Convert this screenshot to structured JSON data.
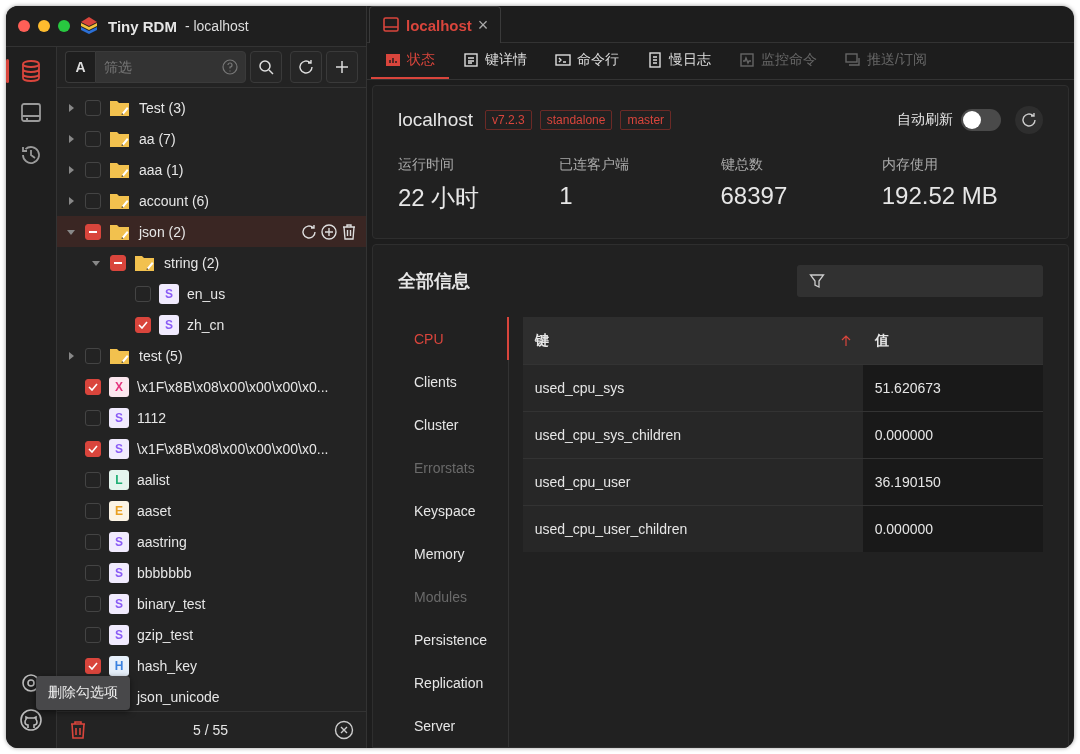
{
  "window": {
    "app_name": "Tiny RDM",
    "title": "- localhost"
  },
  "rail": [
    {
      "kind": "database",
      "selected": true
    },
    {
      "kind": "terminal",
      "selected": false
    },
    {
      "kind": "history",
      "selected": false
    }
  ],
  "toolbar": {
    "case_button": "A",
    "filter": {
      "placeholder": "筛选"
    }
  },
  "tree": [
    {
      "kind": "folder",
      "label": "Test (3)",
      "checked": false,
      "partial": false,
      "expanded": false,
      "selected": false
    },
    {
      "kind": "folder",
      "label": "aa (7)",
      "checked": false,
      "partial": false,
      "expanded": false,
      "selected": false
    },
    {
      "kind": "folder",
      "label": "aaa (1)",
      "checked": false,
      "partial": false,
      "expanded": false,
      "selected": false
    },
    {
      "kind": "folder",
      "label": "account (6)",
      "checked": false,
      "partial": false,
      "expanded": false,
      "selected": false
    },
    {
      "kind": "folder",
      "label": "json (2)",
      "checked": false,
      "partial": true,
      "expanded": true,
      "selected": true,
      "children": [
        {
          "kind": "folder",
          "label": "string (2)",
          "checked": false,
          "partial": true,
          "expanded": true,
          "selected": false,
          "children": [
            {
              "kind": "key",
              "badge": "S",
              "color": "#8b5cf6",
              "label": "en_us",
              "checked": false,
              "selected": false
            },
            {
              "kind": "key",
              "badge": "S",
              "color": "#8b5cf6",
              "label": "zh_cn",
              "checked": true,
              "selected": false
            }
          ]
        }
      ]
    },
    {
      "kind": "folder",
      "label": "test (5)",
      "checked": false,
      "partial": false,
      "expanded": false,
      "selected": false
    },
    {
      "kind": "key",
      "badge": "X",
      "color": "#e5337c",
      "label": "\\x1F\\x8B\\x08\\x00\\x00\\x00\\x0...",
      "checked": true,
      "selected": false
    },
    {
      "kind": "key",
      "badge": "S",
      "color": "#8b5cf6",
      "label": "1112",
      "checked": false,
      "selected": false
    },
    {
      "kind": "key",
      "badge": "S",
      "color": "#8b5cf6",
      "label": "\\x1F\\x8B\\x08\\x00\\x00\\x00\\x0...",
      "checked": true,
      "selected": false
    },
    {
      "kind": "key",
      "badge": "L",
      "color": "#1fae74",
      "label": "aalist",
      "checked": false,
      "selected": false
    },
    {
      "kind": "key",
      "badge": "E",
      "color": "#e9a023",
      "label": "aaset",
      "checked": false,
      "selected": false
    },
    {
      "kind": "key",
      "badge": "S",
      "color": "#8b5cf6",
      "label": "aastring",
      "checked": false,
      "selected": false
    },
    {
      "kind": "key",
      "badge": "S",
      "color": "#8b5cf6",
      "label": "bbbbbbb",
      "checked": false,
      "selected": false
    },
    {
      "kind": "key",
      "badge": "S",
      "color": "#8b5cf6",
      "label": "binary_test",
      "checked": false,
      "selected": false
    },
    {
      "kind": "key",
      "badge": "S",
      "color": "#8b5cf6",
      "label": "gzip_test",
      "checked": false,
      "selected": false
    },
    {
      "kind": "key",
      "badge": "H",
      "color": "#3b82e0",
      "label": "hash_key",
      "checked": true,
      "selected": false
    },
    {
      "kind": "key",
      "label": "json_unicode",
      "selected": false
    }
  ],
  "tooltip": "删除勾选项",
  "footer": {
    "count": "5 / 55"
  },
  "tab": {
    "label": "localhost",
    "close": "×"
  },
  "subtabs": [
    {
      "kind": "status",
      "label": "状态",
      "selected": true,
      "disabled": false
    },
    {
      "kind": "detail",
      "label": "键详情",
      "selected": false,
      "disabled": false
    },
    {
      "kind": "cli",
      "label": "命令行",
      "selected": false,
      "disabled": false
    },
    {
      "kind": "log",
      "label": "慢日志",
      "selected": false,
      "disabled": false
    },
    {
      "kind": "monitor",
      "label": "监控命令",
      "selected": false,
      "disabled": true
    },
    {
      "kind": "pubsub",
      "label": "推送/订阅",
      "selected": false,
      "disabled": true
    }
  ],
  "server": {
    "name": "localhost",
    "tags": [
      "v7.2.3",
      "standalone",
      "master"
    ],
    "auto_refresh": {
      "label": "自动刷新",
      "on": false
    },
    "stats": [
      {
        "label": "运行时间",
        "value": "22 小时"
      },
      {
        "label": "已连客户端",
        "value": "1"
      },
      {
        "label": "键总数",
        "value": "68397"
      },
      {
        "label": "内存使用",
        "value": "192.52 MB"
      }
    ]
  },
  "all_info": {
    "title": "全部信息",
    "sections": [
      {
        "label": "CPU",
        "selected": true,
        "disabled": false
      },
      {
        "label": "Clients",
        "selected": false,
        "disabled": false
      },
      {
        "label": "Cluster",
        "selected": false,
        "disabled": false
      },
      {
        "label": "Errorstats",
        "selected": false,
        "disabled": true
      },
      {
        "label": "Keyspace",
        "selected": false,
        "disabled": false
      },
      {
        "label": "Memory",
        "selected": false,
        "disabled": false
      },
      {
        "label": "Modules",
        "selected": false,
        "disabled": true
      },
      {
        "label": "Persistence",
        "selected": false,
        "disabled": false
      },
      {
        "label": "Replication",
        "selected": false,
        "disabled": false
      },
      {
        "label": "Server",
        "selected": false,
        "disabled": false
      }
    ],
    "table": {
      "columns": [
        "键",
        "值"
      ],
      "sort_ascending": true,
      "rows": [
        [
          "used_cpu_sys",
          "51.620673"
        ],
        [
          "used_cpu_sys_children",
          "0.000000"
        ],
        [
          "used_cpu_user",
          "36.190150"
        ],
        [
          "used_cpu_user_children",
          "0.000000"
        ]
      ]
    }
  }
}
